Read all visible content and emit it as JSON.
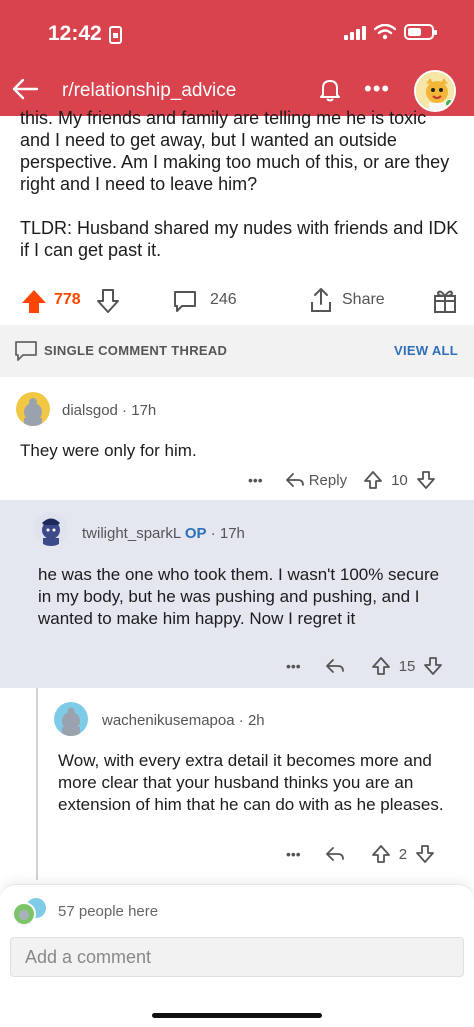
{
  "status": {
    "time": "12:42"
  },
  "header": {
    "title": "r/relationship_advice",
    "more": "•••"
  },
  "post": {
    "cut_line": "this. My friends and family are telling me he is toxic",
    "paragraph1": "and I need to get away, but I wanted an outside perspective. Am I making too much of this, or are they right and I need to leave him?",
    "paragraph2": "TLDR: Husband shared my nudes with friends and IDK if I can get past it.",
    "votes": "778",
    "comments": "246",
    "share_label": "Share"
  },
  "thread": {
    "label": "SINGLE COMMENT THREAD",
    "view_all": "VIEW ALL"
  },
  "comments": [
    {
      "user": "dialsgod",
      "time": "17h",
      "text": "They were only for him.",
      "reply_label": "Reply",
      "votes": "10"
    },
    {
      "user": "twilight_sparkL",
      "op": "OP",
      "time": "17h",
      "text": "he was the one who took them. I wasn't 100% secure in my body, but he was pushing and pushing, and I wanted to make him happy. Now I regret it",
      "votes": "15"
    },
    {
      "user": "wachenikusemapoa",
      "time": "2h",
      "text": "Wow, with every extra detail it becomes more and more clear that your husband thinks you are an extension of him that he can do with as he pleases.",
      "votes": "2"
    }
  ],
  "footer": {
    "people": "57 people here",
    "placeholder": "Add a comment"
  },
  "colors": {
    "header_bg": "#d8434e",
    "upvote": "#ff4500",
    "link_blue": "#2e6fb8",
    "op_highlight_bg": "#e4e6f0"
  }
}
